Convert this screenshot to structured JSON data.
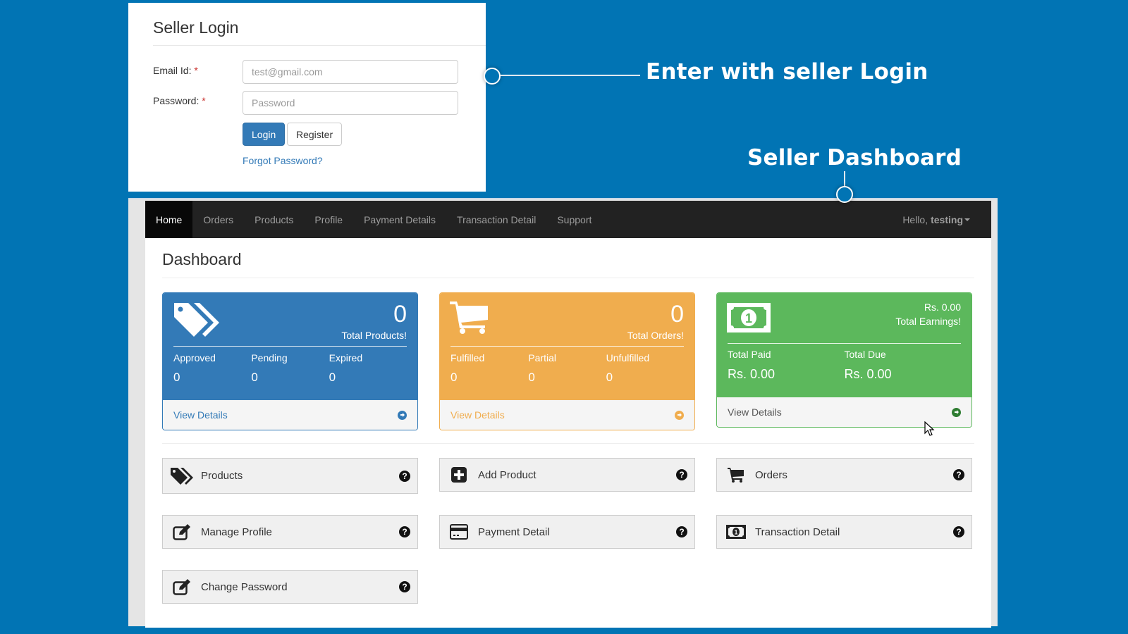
{
  "annotations": {
    "login_callout": "Enter with seller Login",
    "dashboard_callout": "Seller Dashboard"
  },
  "login": {
    "title": "Seller Login",
    "email_label": "Email Id:",
    "email_required": "*",
    "email_value": "",
    "email_placeholder": "test@gmail.com",
    "password_label": "Password:",
    "password_required": "*",
    "password_value": "",
    "password_placeholder": "Password",
    "login_button": "Login",
    "register_button": "Register",
    "forgot_link": "Forgot Password?"
  },
  "navbar": {
    "items": [
      {
        "label": "Home",
        "active": true
      },
      {
        "label": "Orders"
      },
      {
        "label": "Products"
      },
      {
        "label": "Profile"
      },
      {
        "label": "Payment Details"
      },
      {
        "label": "Transaction Detail"
      },
      {
        "label": "Support"
      }
    ],
    "greeting": "Hello,",
    "username": "testing"
  },
  "dashboard": {
    "title": "Dashboard",
    "products_panel": {
      "count": "0",
      "label": "Total Products!",
      "stats": [
        {
          "label": "Approved",
          "value": "0"
        },
        {
          "label": "Pending",
          "value": "0"
        },
        {
          "label": "Expired",
          "value": "0"
        }
      ],
      "footer": "View Details",
      "color": "#337ab7"
    },
    "orders_panel": {
      "count": "0",
      "label": "Total Orders!",
      "stats": [
        {
          "label": "Fulfilled",
          "value": "0"
        },
        {
          "label": "Partial",
          "value": "0"
        },
        {
          "label": "Unfulfilled",
          "value": "0"
        }
      ],
      "footer": "View Details",
      "color": "#f0ad4e"
    },
    "earnings_panel": {
      "amount": "Rs. 0.00",
      "label": "Total Earnings!",
      "stats": [
        {
          "label": "Total Paid",
          "value": "Rs. 0.00"
        },
        {
          "label": "Total Due",
          "value": "Rs. 0.00"
        }
      ],
      "footer": "View Details",
      "color": "#5cb85c"
    },
    "tiles": [
      {
        "label": "Products",
        "icon": "tags-icon"
      },
      {
        "label": "Add Product",
        "icon": "plus-square-icon"
      },
      {
        "label": "Orders",
        "icon": "cart-icon"
      },
      {
        "label": "Manage Profile",
        "icon": "edit-icon"
      },
      {
        "label": "Payment Detail",
        "icon": "credit-card-icon"
      },
      {
        "label": "Transaction Detail",
        "icon": "money-icon"
      },
      {
        "label": "Change Password",
        "icon": "edit-icon"
      }
    ],
    "help_glyph": "?"
  }
}
